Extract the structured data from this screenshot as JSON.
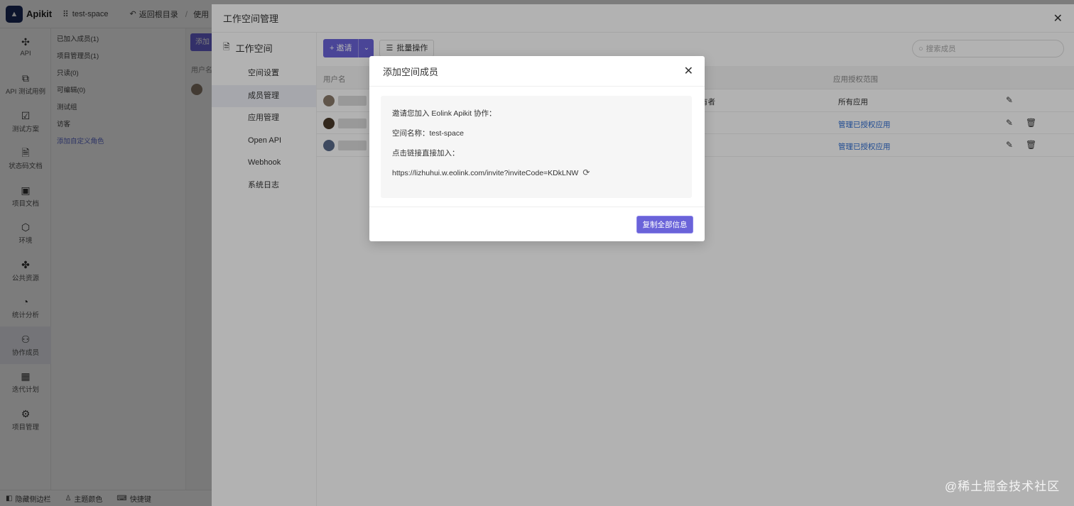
{
  "app": {
    "name": "Apikit",
    "workspace": "test-space",
    "back_label": "返回根目录",
    "crumb_more": "使用",
    "brand_color": "#6a63d9"
  },
  "left_nav": [
    {
      "label": "API",
      "icon": "api-icon"
    },
    {
      "label": "API 测试用例",
      "icon": "test-case-icon"
    },
    {
      "label": "测试方案",
      "icon": "test-plan-icon"
    },
    {
      "label": "状态码文档",
      "icon": "status-doc-icon"
    },
    {
      "label": "项目文档",
      "icon": "project-doc-icon"
    },
    {
      "label": "环境",
      "icon": "environment-icon"
    },
    {
      "label": "公共资源",
      "icon": "puzzle-icon"
    },
    {
      "label": "统计分析",
      "icon": "chart-icon"
    },
    {
      "label": "协作成员",
      "icon": "members-icon",
      "active": true
    },
    {
      "label": "迭代计划",
      "icon": "calendar-icon"
    },
    {
      "label": "项目管理",
      "icon": "gear-icon"
    }
  ],
  "role_list": [
    {
      "label": "已加入成员(1)"
    },
    {
      "label": "项目管理员(1)"
    },
    {
      "label": "只读(0)"
    },
    {
      "label": "可编辑(0)"
    },
    {
      "label": "测试组"
    },
    {
      "label": "访客"
    },
    {
      "label": "添加自定义角色",
      "link": true
    }
  ],
  "underlay": {
    "add_label": "添加",
    "header_label": "用户名"
  },
  "bottom_bar": {
    "hide_sidebar": "隐藏侧边栏",
    "theme": "主题颜色",
    "shortcuts": "快捷键"
  },
  "drawer": {
    "title": "工作空间管理",
    "side_heading": "工作空间",
    "side_items": [
      "空间设置",
      "成员管理",
      "应用管理",
      "Open API",
      "Webhook",
      "系统日志"
    ],
    "active_side_index": 1,
    "invite_label": "+ 邀请",
    "batch_label": "批量操作",
    "search_placeholder": "搜索成员",
    "columns": {
      "user": "用户名",
      "scope": "应用授权范围"
    },
    "rows": [
      {
        "role": "有者",
        "scope": "所有应用",
        "scope_is_link": false,
        "deletable": false
      },
      {
        "role": "",
        "scope": "管理已授权应用",
        "scope_is_link": true,
        "deletable": true
      },
      {
        "role": "",
        "scope": "管理已授权应用",
        "scope_is_link": true,
        "deletable": true
      }
    ]
  },
  "modal": {
    "title": "添加空间成员",
    "lines": {
      "intro": "邀请您加入 Eolink Apikit 协作：",
      "space": "空间名称：test-space",
      "link_label": "点击链接直接加入：",
      "link": "https://lizhuhui.w.eolink.com/invite?inviteCode=KDkLNW"
    },
    "copy_button": "复制全部信息"
  },
  "watermark": "@稀土掘金技术社区"
}
